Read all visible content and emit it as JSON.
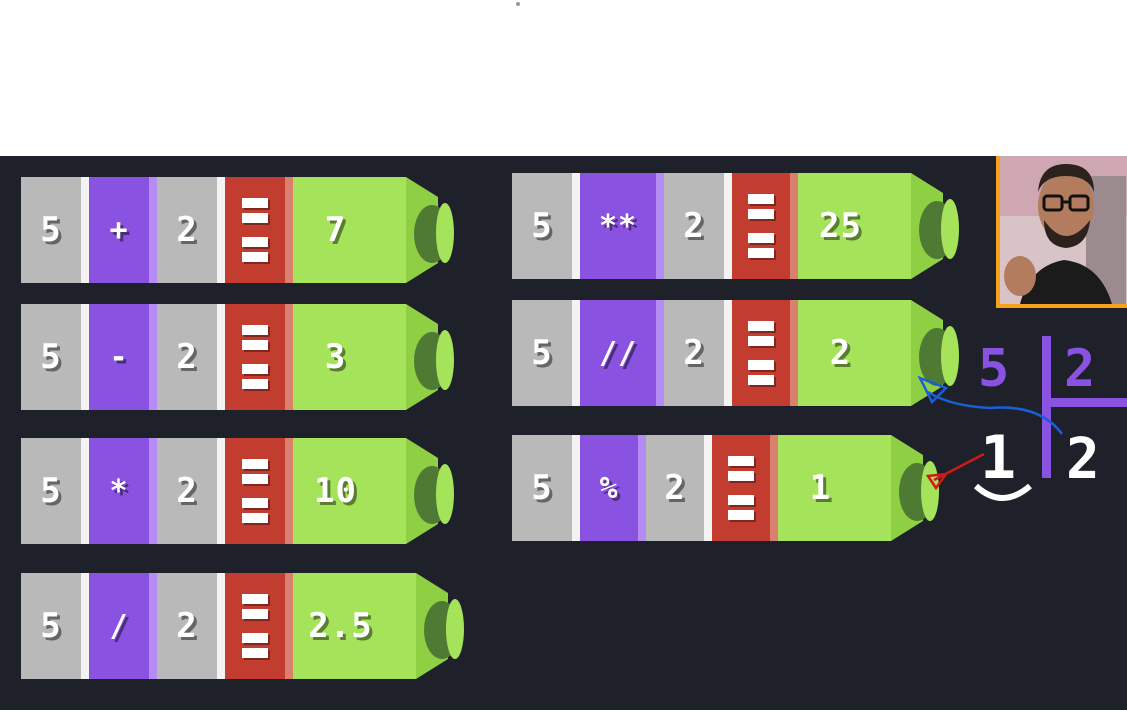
{
  "colors": {
    "board_bg": "#1e2129",
    "number_block": "#b9b9b9",
    "operator_block": "#8a52e0",
    "equals_block": "#c23d2f",
    "result_block": "#a4e35a",
    "result_cap": "#4f7a33",
    "webcam_border": "#f6a11c",
    "division_purple": "#8a52e0",
    "arrow_blue": "#1a5fd6",
    "arrow_red": "#d01818"
  },
  "operations": [
    {
      "left": "5",
      "op": "+",
      "right": "2",
      "result": "7"
    },
    {
      "left": "5",
      "op": "-",
      "right": "2",
      "result": "3"
    },
    {
      "left": "5",
      "op": "*",
      "right": "2",
      "result": "10"
    },
    {
      "left": "5",
      "op": "/",
      "right": "2",
      "result": "2.5"
    },
    {
      "left": "5",
      "op": "**",
      "right": "2",
      "result": "25"
    },
    {
      "left": "5",
      "op": "//",
      "right": "2",
      "result": "2"
    },
    {
      "left": "5",
      "op": "%",
      "right": "2",
      "result": "1"
    }
  ],
  "division_diagram": {
    "dividend": "5",
    "divisor": "2",
    "remainder": "1",
    "quotient": "2"
  },
  "webcam": {
    "icon": "presenter-webcam"
  }
}
